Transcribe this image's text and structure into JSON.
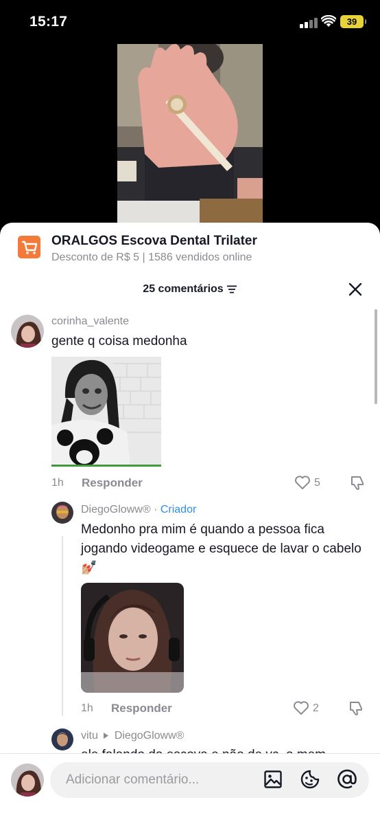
{
  "status_bar": {
    "time": "15:17",
    "battery": "39"
  },
  "product": {
    "title": "ORALGOS Escova Dental Trilater",
    "subtitle": "Desconto de R$ 5 | 1586 vendidos online",
    "accent": "#f27b3b"
  },
  "comments_header": {
    "count_label": "25 comentários"
  },
  "comments": [
    {
      "username": "corinha_valente",
      "text": "gente q coisa medonha",
      "time": "1h",
      "reply_label": "Responder",
      "likes": "5"
    }
  ],
  "replies": [
    {
      "username": "DiegoGloww®",
      "separator": "·",
      "badge": "Criador",
      "badge_color": "#2f8ee8",
      "text": "Medonho pra mim é quando a pessoa fica jogando videogame e esquece de lavar o cabelo",
      "emoji": "💅🏼",
      "time": "1h",
      "reply_label": "Responder",
      "likes": "2"
    },
    {
      "username": "vitu",
      "reply_to": "DiegoGloww®",
      "text": "ele falando da escova e não de vc, o mem"
    }
  ],
  "input": {
    "placeholder": "Adicionar comentário..."
  }
}
